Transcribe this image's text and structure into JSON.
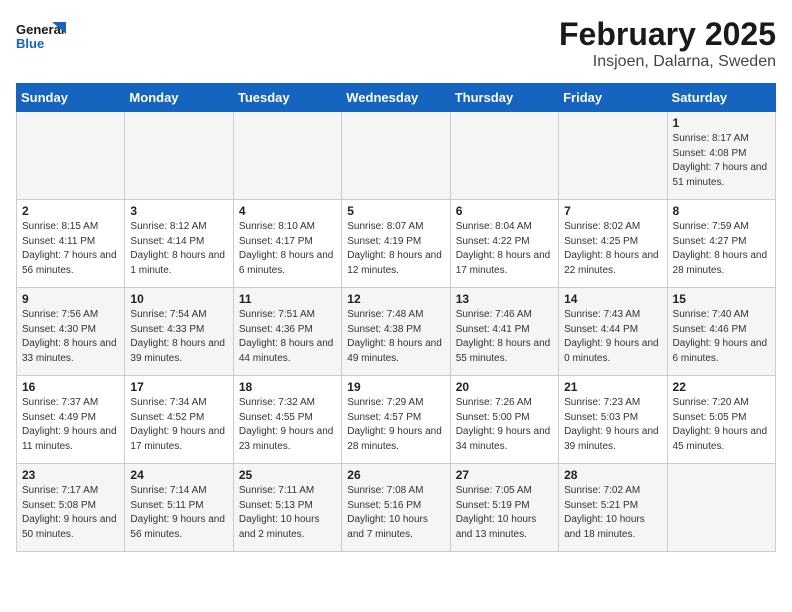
{
  "header": {
    "logo_general": "General",
    "logo_blue": "Blue",
    "title": "February 2025",
    "subtitle": "Insjoen, Dalarna, Sweden"
  },
  "days_of_week": [
    "Sunday",
    "Monday",
    "Tuesday",
    "Wednesday",
    "Thursday",
    "Friday",
    "Saturday"
  ],
  "weeks": [
    [
      {
        "day": "",
        "info": ""
      },
      {
        "day": "",
        "info": ""
      },
      {
        "day": "",
        "info": ""
      },
      {
        "day": "",
        "info": ""
      },
      {
        "day": "",
        "info": ""
      },
      {
        "day": "",
        "info": ""
      },
      {
        "day": "1",
        "info": "Sunrise: 8:17 AM\nSunset: 4:08 PM\nDaylight: 7 hours\nand 51 minutes."
      }
    ],
    [
      {
        "day": "2",
        "info": "Sunrise: 8:15 AM\nSunset: 4:11 PM\nDaylight: 7 hours\nand 56 minutes."
      },
      {
        "day": "3",
        "info": "Sunrise: 8:12 AM\nSunset: 4:14 PM\nDaylight: 8 hours\nand 1 minute."
      },
      {
        "day": "4",
        "info": "Sunrise: 8:10 AM\nSunset: 4:17 PM\nDaylight: 8 hours\nand 6 minutes."
      },
      {
        "day": "5",
        "info": "Sunrise: 8:07 AM\nSunset: 4:19 PM\nDaylight: 8 hours\nand 12 minutes."
      },
      {
        "day": "6",
        "info": "Sunrise: 8:04 AM\nSunset: 4:22 PM\nDaylight: 8 hours\nand 17 minutes."
      },
      {
        "day": "7",
        "info": "Sunrise: 8:02 AM\nSunset: 4:25 PM\nDaylight: 8 hours\nand 22 minutes."
      },
      {
        "day": "8",
        "info": "Sunrise: 7:59 AM\nSunset: 4:27 PM\nDaylight: 8 hours\nand 28 minutes."
      }
    ],
    [
      {
        "day": "9",
        "info": "Sunrise: 7:56 AM\nSunset: 4:30 PM\nDaylight: 8 hours\nand 33 minutes."
      },
      {
        "day": "10",
        "info": "Sunrise: 7:54 AM\nSunset: 4:33 PM\nDaylight: 8 hours\nand 39 minutes."
      },
      {
        "day": "11",
        "info": "Sunrise: 7:51 AM\nSunset: 4:36 PM\nDaylight: 8 hours\nand 44 minutes."
      },
      {
        "day": "12",
        "info": "Sunrise: 7:48 AM\nSunset: 4:38 PM\nDaylight: 8 hours\nand 49 minutes."
      },
      {
        "day": "13",
        "info": "Sunrise: 7:46 AM\nSunset: 4:41 PM\nDaylight: 8 hours\nand 55 minutes."
      },
      {
        "day": "14",
        "info": "Sunrise: 7:43 AM\nSunset: 4:44 PM\nDaylight: 9 hours\nand 0 minutes."
      },
      {
        "day": "15",
        "info": "Sunrise: 7:40 AM\nSunset: 4:46 PM\nDaylight: 9 hours\nand 6 minutes."
      }
    ],
    [
      {
        "day": "16",
        "info": "Sunrise: 7:37 AM\nSunset: 4:49 PM\nDaylight: 9 hours\nand 11 minutes."
      },
      {
        "day": "17",
        "info": "Sunrise: 7:34 AM\nSunset: 4:52 PM\nDaylight: 9 hours\nand 17 minutes."
      },
      {
        "day": "18",
        "info": "Sunrise: 7:32 AM\nSunset: 4:55 PM\nDaylight: 9 hours\nand 23 minutes."
      },
      {
        "day": "19",
        "info": "Sunrise: 7:29 AM\nSunset: 4:57 PM\nDaylight: 9 hours\nand 28 minutes."
      },
      {
        "day": "20",
        "info": "Sunrise: 7:26 AM\nSunset: 5:00 PM\nDaylight: 9 hours\nand 34 minutes."
      },
      {
        "day": "21",
        "info": "Sunrise: 7:23 AM\nSunset: 5:03 PM\nDaylight: 9 hours\nand 39 minutes."
      },
      {
        "day": "22",
        "info": "Sunrise: 7:20 AM\nSunset: 5:05 PM\nDaylight: 9 hours\nand 45 minutes."
      }
    ],
    [
      {
        "day": "23",
        "info": "Sunrise: 7:17 AM\nSunset: 5:08 PM\nDaylight: 9 hours\nand 50 minutes."
      },
      {
        "day": "24",
        "info": "Sunrise: 7:14 AM\nSunset: 5:11 PM\nDaylight: 9 hours\nand 56 minutes."
      },
      {
        "day": "25",
        "info": "Sunrise: 7:11 AM\nSunset: 5:13 PM\nDaylight: 10 hours\nand 2 minutes."
      },
      {
        "day": "26",
        "info": "Sunrise: 7:08 AM\nSunset: 5:16 PM\nDaylight: 10 hours\nand 7 minutes."
      },
      {
        "day": "27",
        "info": "Sunrise: 7:05 AM\nSunset: 5:19 PM\nDaylight: 10 hours\nand 13 minutes."
      },
      {
        "day": "28",
        "info": "Sunrise: 7:02 AM\nSunset: 5:21 PM\nDaylight: 10 hours\nand 18 minutes."
      },
      {
        "day": "",
        "info": ""
      }
    ]
  ]
}
